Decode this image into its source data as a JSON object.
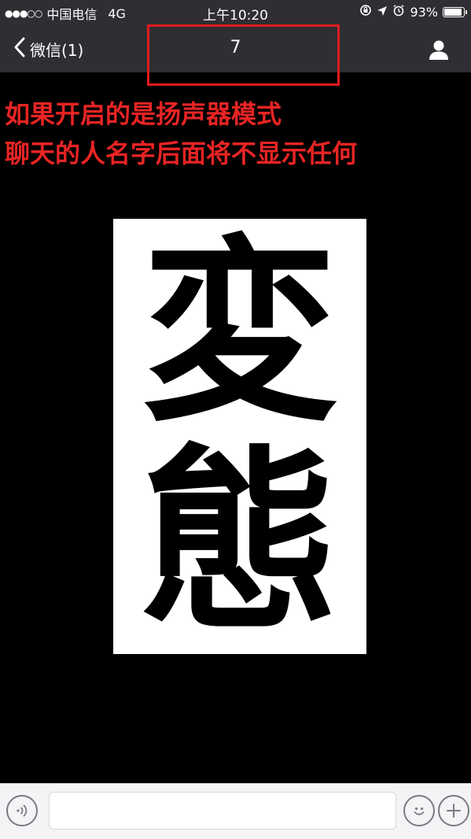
{
  "status_bar": {
    "signal_dots": "●●●○○",
    "carrier": "中国电信",
    "network": "4G",
    "time": "上午10:20",
    "battery_percent_label": "93%",
    "battery_level": 0.93,
    "icons": [
      "lock-rotation-icon",
      "location-arrow-icon",
      "alarm-icon",
      "battery-icon"
    ]
  },
  "nav_bar": {
    "back_label": "微信(1)",
    "title": "7",
    "icons": [
      "chevron-left-icon",
      "profile-icon"
    ]
  },
  "annotation": {
    "line1": "如果开启的是扬声器模式",
    "line2": "聊天的人名字后面将不显示任何"
  },
  "sticker": {
    "glyph_top": "変",
    "glyph_bottom": "態"
  },
  "input_bar": {
    "value": "",
    "placeholder": "",
    "icons": [
      "voice-icon",
      "emoji-icon",
      "plus-icon"
    ]
  },
  "colors": {
    "bar_background": "#2e2e33",
    "annotation_red": "#e82424",
    "highlight_border": "#e01b1b",
    "chat_background": "#000000"
  }
}
